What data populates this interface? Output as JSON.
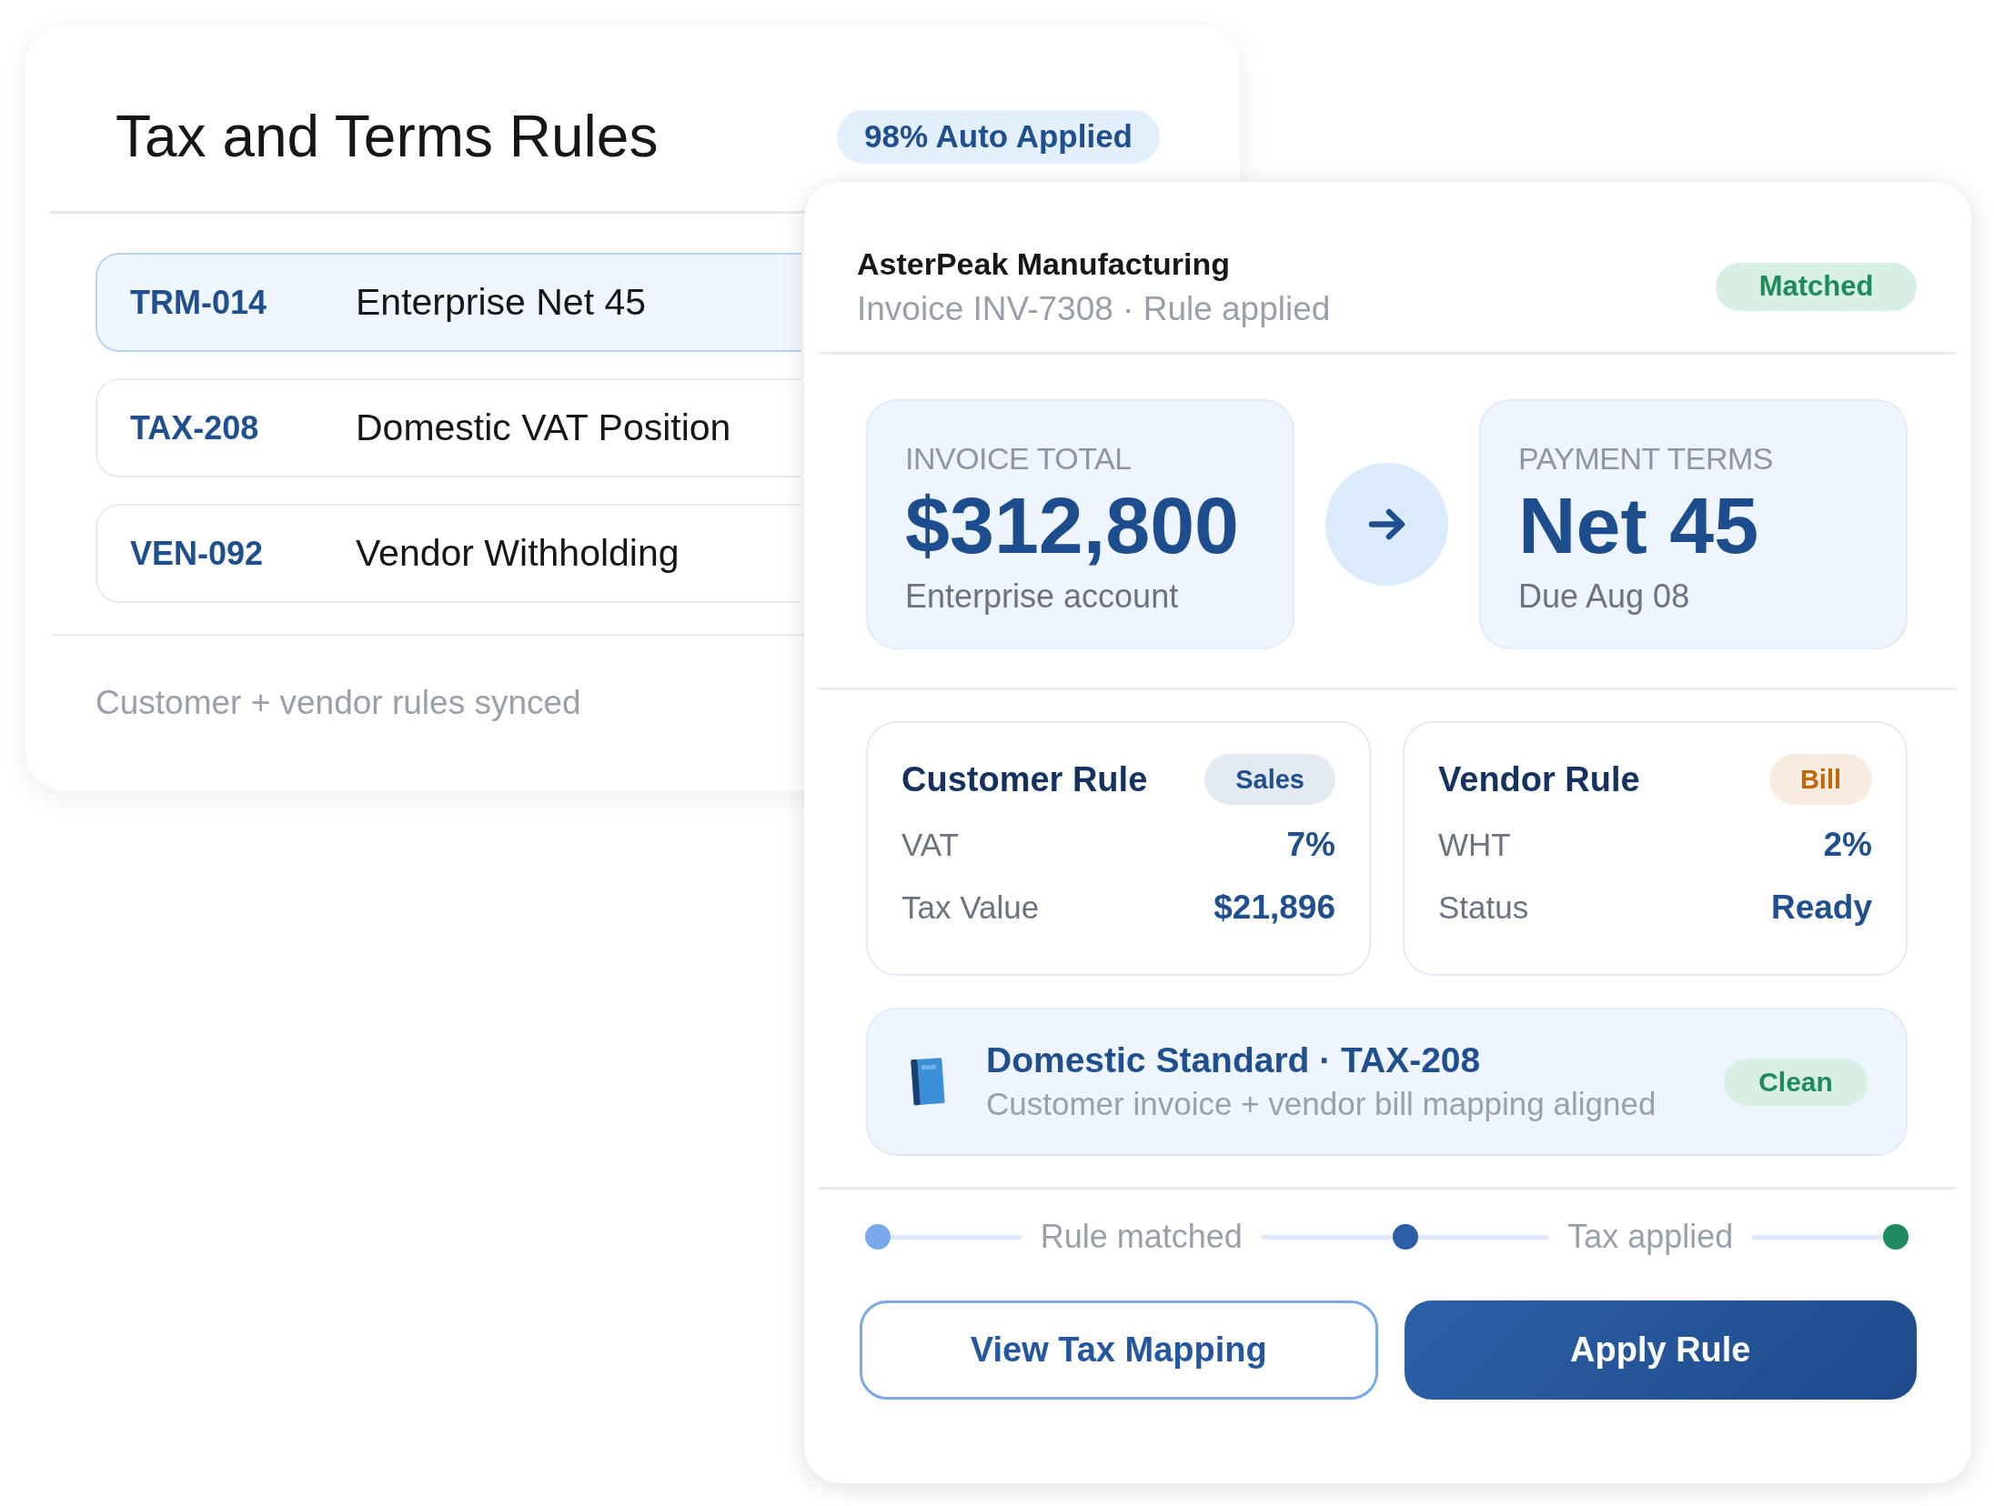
{
  "rules_panel": {
    "title": "Tax and Terms Rules",
    "badge": "98% Auto Applied",
    "rules": [
      {
        "code": "TRM-014",
        "name": "Enterprise Net 45",
        "selected": true
      },
      {
        "code": "TAX-208",
        "name": "Domestic VAT Position",
        "selected": false
      },
      {
        "code": "VEN-092",
        "name": "Vendor Withholding",
        "selected": false
      }
    ],
    "footer": "Customer + vendor rules synced"
  },
  "invoice_panel": {
    "company": "AsterPeak Manufacturing",
    "subtitle": "Invoice INV-7308 · Rule applied",
    "status": "Matched",
    "stats": [
      {
        "label": "INVOICE TOTAL",
        "value": "$312,800",
        "note": "Enterprise account"
      },
      {
        "label": "PAYMENT TERMS",
        "value": "Net 45",
        "note": "Due Aug 08"
      }
    ],
    "rule_cards": [
      {
        "title": "Customer Rule",
        "tag": "Sales",
        "color": "#1f4f8f",
        "rows": [
          {
            "label": "VAT",
            "value": "7%"
          },
          {
            "label": "Tax Value",
            "value": "$21,896"
          }
        ]
      },
      {
        "title": "Vendor Rule",
        "tag": "Bill",
        "color": "#c2660a",
        "rows": [
          {
            "label": "WHT",
            "value": "2%"
          },
          {
            "label": "Status",
            "value": "Ready"
          }
        ]
      }
    ],
    "mapping": {
      "title": "Domestic Standard · TAX-208",
      "description": "Customer invoice + vendor bill mapping aligned",
      "status": "Clean"
    },
    "progress": {
      "points": [
        {
          "color": "#79a9ec"
        },
        {
          "color": "#2a5ea6"
        },
        {
          "color": "#1f8a5b"
        }
      ],
      "labels": [
        "Rule matched",
        "Tax applied"
      ]
    },
    "buttons": [
      {
        "label": "View Tax Mapping",
        "kind": "secondary"
      },
      {
        "label": "Apply Rule",
        "kind": "primary"
      }
    ]
  }
}
